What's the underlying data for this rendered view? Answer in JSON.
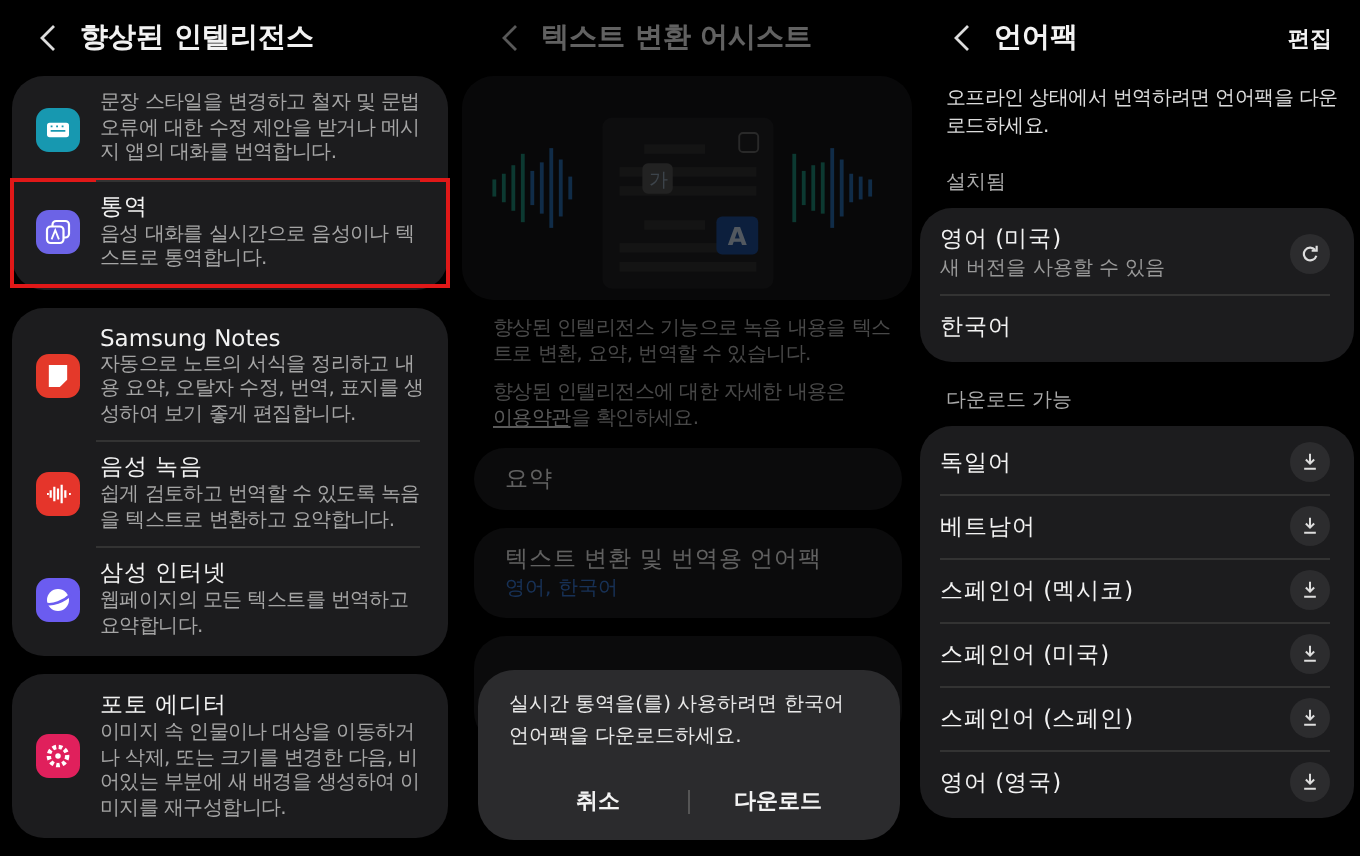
{
  "intelligence_screen": {
    "title": "향상된 인텔리전스",
    "cards": [
      {
        "items": [
          {
            "kind": "keyboard",
            "color": "#1798b0",
            "description": "문장 스타일을 변경하고 철자 및 문법 오류에 대한 수정 제안을 받거나 메시지 앱의 대화를 번역합니다.",
            "highlighted": false
          },
          {
            "kind": "translate",
            "color": "#6c63e6",
            "title": "통역",
            "description": "음성 대화를 실시간으로 음성이나 텍스트로 통역합니다.",
            "highlighted": true
          }
        ]
      },
      {
        "items": [
          {
            "kind": "notes",
            "color": "#e4392a",
            "title": "Samsung Notes",
            "description": "자동으로 노트의 서식을 정리하고 내용 요약, 오탈자 수정, 번역, 표지를 생성하여 보기 좋게 편집합니다.",
            "highlighted": false
          },
          {
            "kind": "recorder",
            "color": "#e5352b",
            "title": "음성 녹음",
            "description": "쉽게 검토하고 번역할 수 있도록 녹음을 텍스트로 변환하고 요약합니다.",
            "highlighted": false
          },
          {
            "kind": "internet",
            "color": "#6b5cf0",
            "title": "삼성 인터넷",
            "description": "웹페이지의 모든 텍스트를 번역하고 요약합니다.",
            "highlighted": false
          }
        ]
      },
      {
        "items": [
          {
            "kind": "photo",
            "color": "#e0205c",
            "title": "포토 에디터",
            "description": "이미지 속 인물이나 대상을 이동하거나 삭제, 또는 크기를 변경한 다음, 비어있는 부분에 새 배경을 생성하여 이미지를 재구성합니다.",
            "highlighted": false
          }
        ]
      }
    ]
  },
  "transcript_assist_screen": {
    "title": "텍스트 변환 어시스트",
    "illustration": {
      "source_glyph": "가",
      "target_glyph": "A"
    },
    "description": "향상된 인텔리전스 기능으로 녹음 내용을 텍스트로 변환, 요약, 번역할 수 있습니다.",
    "terms_before": "향상된 인텔리전스에 대한 자세한 내용은 ",
    "terms_link": "이용약관",
    "terms_after": "을 확인하세요.",
    "cards": [
      {
        "title": "요약"
      },
      {
        "title": "텍스트 변환 및 번역용 언어팩",
        "subtitle": "영어, 한국어"
      }
    ],
    "dialog": {
      "message": "실시간 통역을(를) 사용하려면 한국어 언어팩을 다운로드하세요.",
      "buttons": [
        "취소",
        "다운로드"
      ]
    }
  },
  "language_packs_screen": {
    "title": "언어팩",
    "edit": "편집",
    "description": "오프라인 상태에서 번역하려면 언어팩을 다운로드하세요.",
    "installed_label": "설치됨",
    "installed": [
      {
        "name": "영어 (미국)",
        "status": "새 버전을 사용할 수 있음",
        "update_available": true
      },
      {
        "name": "한국어",
        "update_available": false
      }
    ],
    "available_label": "다운로드 가능",
    "available": [
      {
        "name": "독일어"
      },
      {
        "name": "베트남어"
      },
      {
        "name": "스페인어 (멕시코)"
      },
      {
        "name": "스페인어 (미국)"
      },
      {
        "name": "스페인어 (스페인)"
      },
      {
        "name": "영어 (영국)"
      }
    ]
  }
}
